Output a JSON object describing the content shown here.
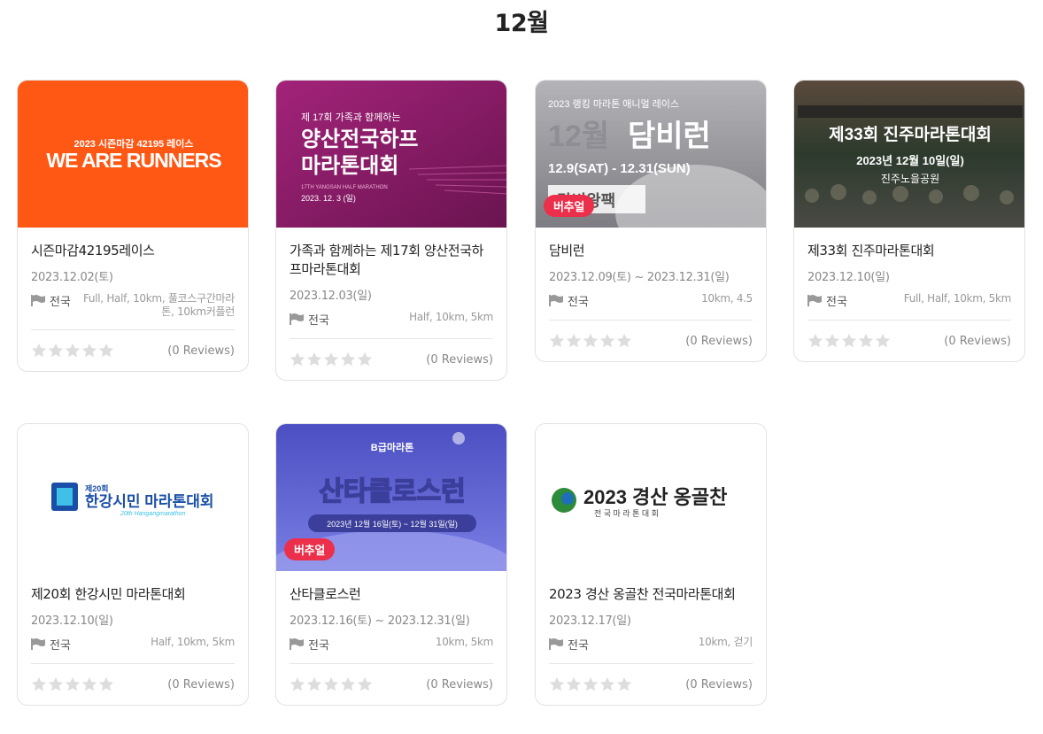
{
  "page": {
    "month_title": "12월"
  },
  "cards": [
    {
      "title": "시즌마감42195레이스",
      "date": "2023.12.02(토)",
      "region": "전국",
      "distances": "Full, Half, 10km, 풀코스구간마라톤, 10km커플런",
      "reviews": "(0 Reviews)",
      "rating": 0,
      "badge": "",
      "thumb": {
        "top_text": "2023 시즌마감 42195 레이스",
        "main_text": "WE ARE RUNNERS",
        "bg": "#ff5714"
      }
    },
    {
      "title": "가족과 함께하는 제17회 양산전국하프마라톤대회",
      "date": "2023.12.03(일)",
      "region": "전국",
      "distances": "Half, 10km, 5km",
      "reviews": "(0 Reviews)",
      "rating": 0,
      "badge": "",
      "thumb": {
        "top_text": "제 17회 가족과 함께하는",
        "main_line1": "양산전국하프",
        "main_line2": "마라톤대회",
        "sub_text": "17TH YANGSAN HALF MARATHON",
        "date_text": "2023. 12. 3 (일)",
        "bg": "#8c1b6a"
      }
    },
    {
      "title": "담비런",
      "date": "2023.12.09(토) ~ 2023.12.31(일)",
      "region": "전국",
      "distances": "10km, 4.5",
      "reviews": "(0 Reviews)",
      "rating": 0,
      "badge": "버추얼",
      "thumb": {
        "top_text": "2023 랭킹 마라톤 애니멀 레이스",
        "month_text": "12월",
        "main_text": "담비런",
        "date_text": "12.9(SAT) - 12.31(SUN)",
        "label_text": "담비왕팩",
        "bg": "#9a9aa0"
      }
    },
    {
      "title": "제33회 진주마라톤대회",
      "date": "2023.12.10(일)",
      "region": "전국",
      "distances": "Full, Half, 10km, 5km",
      "reviews": "(0 Reviews)",
      "rating": 0,
      "badge": "",
      "thumb": {
        "main_text": "제33회 진주마라톤대회",
        "date_text": "2023년 12월 10일(일)",
        "place_text": "진주노을공원",
        "bg": "#3a3f3a"
      }
    },
    {
      "title": "제20회 한강시민 마라톤대회",
      "date": "2023.12.10(일)",
      "region": "전국",
      "distances": "Half, 10km, 5km",
      "reviews": "(0 Reviews)",
      "rating": 0,
      "badge": "",
      "thumb": {
        "top_text": "제20회",
        "main_text": "한강시민 마라톤대회",
        "sub_text": "20th Hangangmarathon",
        "bg": "#ffffff"
      }
    },
    {
      "title": "산타클로스런",
      "date": "2023.12.16(토) ~ 2023.12.31(일)",
      "region": "전국",
      "distances": "10km, 5km",
      "reviews": "(0 Reviews)",
      "rating": 0,
      "badge": "버추얼",
      "thumb": {
        "top_text": "B급마라톤",
        "main_text": "산타클로스런",
        "date_text": "2023년 12월 16일(토) ~ 12월 31일(일)",
        "bg": "#5e5fd1"
      }
    },
    {
      "title": "2023 경산 옹골찬 전국마라톤대회",
      "date": "2023.12.17(일)",
      "region": "전국",
      "distances": "10km, 걷기",
      "reviews": "(0 Reviews)",
      "rating": 0,
      "badge": "",
      "thumb": {
        "main_text": "2023 경산 옹골찬",
        "sub_text": "전 국 마 라 톤 대 회",
        "bg": "#ffffff"
      }
    }
  ],
  "colors": {
    "badge": "#ec2f4b",
    "star_empty": "#dddddd",
    "text_muted": "#888888"
  },
  "icons": {
    "region": "flag-icon",
    "rating": "star-icon"
  }
}
